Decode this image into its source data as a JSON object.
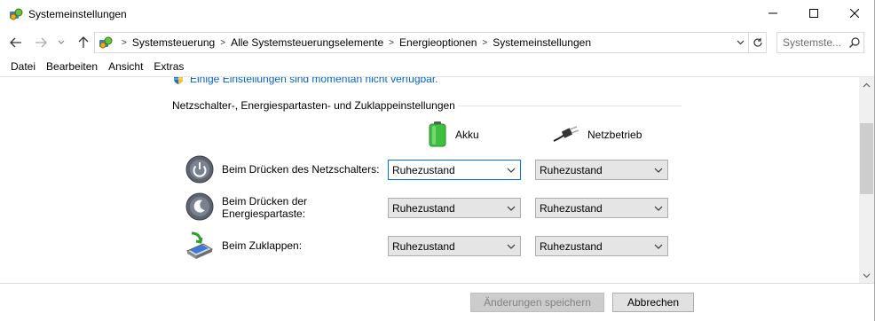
{
  "window": {
    "title": "Systemeinstellungen",
    "minimize_glyph": "—",
    "maximize_glyph": "☐",
    "close_glyph": "✕"
  },
  "nav": {
    "breadcrumbs": [
      "Systemsteuerung",
      "Alle Systemsteuerungselemente",
      "Energieoptionen",
      "Systemeinstellungen"
    ],
    "search_placeholder": "Systemste..."
  },
  "menu": [
    "Datei",
    "Bearbeiten",
    "Ansicht",
    "Extras"
  ],
  "content": {
    "notice": "Einige Einstellungen sind momentan nicht verfügbar.",
    "section_title": "Netzschalter-, Energiespartasten- und Zuklappeinstellungen",
    "columns": {
      "battery": "Akku",
      "plugged_in": "Netzbetrieb"
    },
    "rows": [
      {
        "label": "Beim Drücken des Netzschalters:",
        "battery_value": "Ruhezustand",
        "plugged_value": "Ruhezustand"
      },
      {
        "label_line1": "Beim Drücken der",
        "label_line2": "Energiespartaste:",
        "battery_value": "Ruhezustand",
        "plugged_value": "Ruhezustand"
      },
      {
        "label": "Beim Zuklappen:",
        "battery_value": "Ruhezustand",
        "plugged_value": "Ruhezustand"
      }
    ]
  },
  "footer": {
    "save_label": "Änderungen speichern",
    "cancel_label": "Abbrechen"
  },
  "icons": {
    "app": "control-panel-icon",
    "back": "back-arrow-icon",
    "forward": "forward-arrow-icon",
    "recent": "chevron-down-icon",
    "up": "up-arrow-icon",
    "refresh": "refresh-icon",
    "search": "search-icon",
    "shield": "uac-shield-icon",
    "battery": "battery-icon",
    "plug": "power-plug-icon",
    "power": "power-button-icon",
    "sleep": "sleep-button-icon",
    "lid": "laptop-lid-icon"
  },
  "colors": {
    "link": "#0066cc",
    "focus": "#0078d7",
    "battery_green": "#3fbf3f"
  }
}
